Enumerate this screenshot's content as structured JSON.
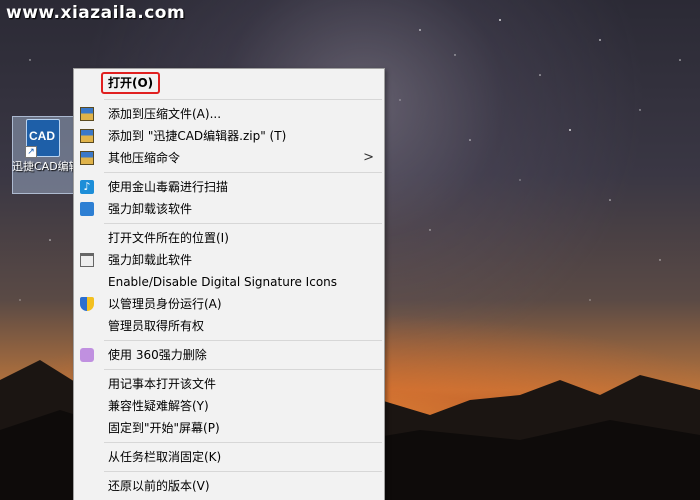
{
  "watermark": "www.xiazaila.com",
  "desktop_icon": {
    "app_badge": "CAD",
    "label": "迅捷CAD编辑器"
  },
  "context_menu": {
    "open_label": "打开(O)",
    "groups": [
      [
        {
          "label": "添加到压缩文件(A)...",
          "icon": "archive-icon"
        },
        {
          "label": "添加到 \"迅捷CAD编辑器.zip\" (T)",
          "icon": "archive-icon"
        },
        {
          "label": "其他压缩命令",
          "icon": "archive-icon",
          "submenu": ">"
        }
      ],
      [
        {
          "label": "使用金山毒霸进行扫描",
          "icon": "antivirus-scan-icon"
        },
        {
          "label": "强力卸载该软件",
          "icon": "uninstall-icon"
        }
      ],
      [
        {
          "label": "打开文件所在的位置(I)",
          "icon": ""
        },
        {
          "label": "强力卸载此软件",
          "icon": "trash-icon"
        },
        {
          "label": "Enable/Disable Digital Signature Icons",
          "icon": ""
        },
        {
          "label": "以管理员身份运行(A)",
          "icon": "uac-shield-icon"
        },
        {
          "label": "管理员取得所有权",
          "icon": ""
        }
      ],
      [
        {
          "label": "使用 360强力删除",
          "icon": "360-delete-icon"
        }
      ],
      [
        {
          "label": "用记事本打开该文件",
          "icon": ""
        },
        {
          "label": "兼容性疑难解答(Y)",
          "icon": ""
        },
        {
          "label": "固定到\"开始\"屏幕(P)",
          "icon": ""
        }
      ],
      [
        {
          "label": "从任务栏取消固定(K)",
          "icon": ""
        }
      ],
      [
        {
          "label": "还原以前的版本(V)",
          "icon": ""
        }
      ]
    ]
  }
}
